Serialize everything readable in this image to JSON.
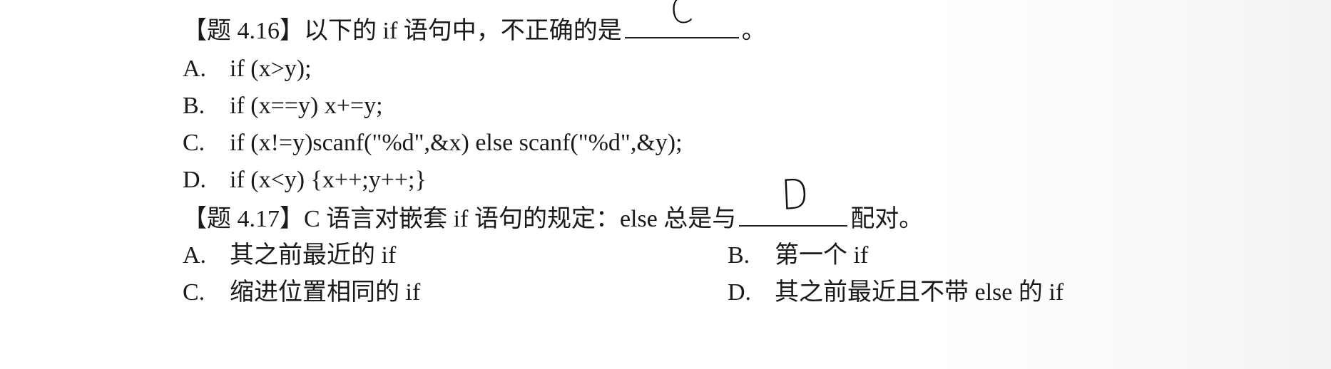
{
  "q416": {
    "title_prefix": "【题 4.16】以下的 if 语句中，不正确的是",
    "handwritten_answer": "C",
    "title_suffix": "。",
    "options": [
      {
        "letter": "A.",
        "text": "if (x>y);"
      },
      {
        "letter": "B.",
        "text": "if (x==y) x+=y;"
      },
      {
        "letter": "C.",
        "text": "if (x!=y)scanf(\"%d\",&x) else scanf(\"%d\",&y);"
      },
      {
        "letter": "D.",
        "text": "if (x<y) {x++;y++;}"
      }
    ]
  },
  "q417": {
    "title_prefix": "【题 4.17】C 语言对嵌套 if 语句的规定：else 总是与",
    "handwritten_answer": "D",
    "title_suffix": "配对。",
    "options": [
      {
        "letter": "A.",
        "text": "其之前最近的 if"
      },
      {
        "letter": "B.",
        "text": "第一个 if"
      },
      {
        "letter": "C.",
        "text": "缩进位置相同的 if"
      },
      {
        "letter": "D.",
        "text": "其之前最近且不带 else 的 if"
      }
    ]
  }
}
